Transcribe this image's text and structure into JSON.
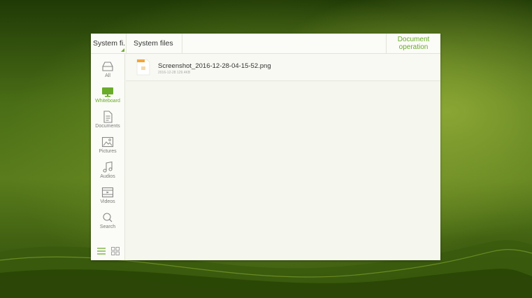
{
  "topbar": {
    "directory_select": "System fi...",
    "breadcrumb": "System files",
    "document_operation_line1": "Document",
    "document_operation_line2": "operation"
  },
  "sidebar": {
    "items": [
      {
        "label": "All",
        "icon": "drive-icon",
        "active": false
      },
      {
        "label": "Whiteboard",
        "icon": "whiteboard-icon",
        "active": true
      },
      {
        "label": "Documents",
        "icon": "document-icon",
        "active": false
      },
      {
        "label": "Pictures",
        "icon": "picture-icon",
        "active": false
      },
      {
        "label": "Audios",
        "icon": "music-icon",
        "active": false
      },
      {
        "label": "Videos",
        "icon": "video-icon",
        "active": false
      },
      {
        "label": "Search",
        "icon": "search-icon",
        "active": false
      }
    ],
    "view_modes": [
      "list-view-icon",
      "grid-view-icon"
    ]
  },
  "files": [
    {
      "name": "Screenshot_2016-12-28-04-15-52.png",
      "date": "2016-12-28",
      "size": "129.4KB",
      "icon": "image-file-icon"
    }
  ],
  "colors": {
    "accent": "#6aab2a",
    "file_badge": "#f2a63a"
  }
}
